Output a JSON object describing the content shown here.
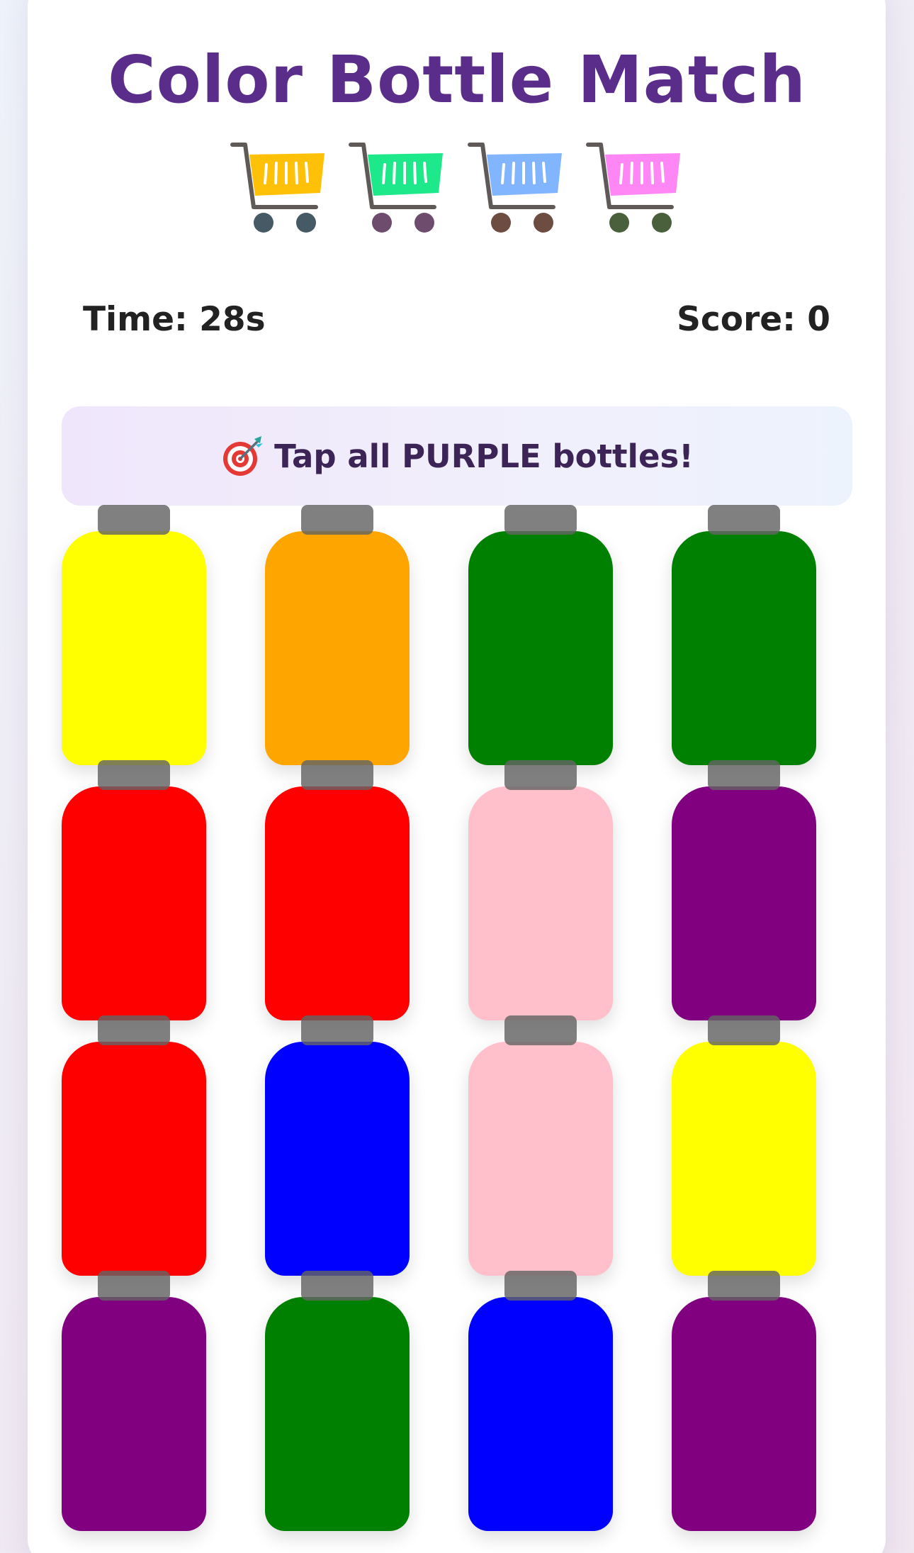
{
  "game": {
    "title": "Color Bottle Match",
    "timer_text": "Time: 28s",
    "score_text": "Score: 0",
    "instruction_icon": "target-dart-icon",
    "instruction_text": "Tap all PURPLE bottles!"
  },
  "carts": [
    {
      "icon": "shopping-cart-icon",
      "basket_color": "#ffc107",
      "wheel_color": "#455a64"
    },
    {
      "icon": "shopping-cart-icon",
      "basket_color": "#1de98b",
      "wheel_color": "#6d4c6e"
    },
    {
      "icon": "shopping-cart-icon",
      "basket_color": "#82b5ff",
      "wheel_color": "#6d4c41"
    },
    {
      "icon": "shopping-cart-icon",
      "basket_color": "#ff86f5",
      "wheel_color": "#4a5f3c"
    }
  ],
  "bottles": [
    {
      "color_name": "yellow",
      "color": "#ffff00"
    },
    {
      "color_name": "orange",
      "color": "#ffa500"
    },
    {
      "color_name": "green",
      "color": "#008000"
    },
    {
      "color_name": "green",
      "color": "#008000"
    },
    {
      "color_name": "red",
      "color": "#ff0000"
    },
    {
      "color_name": "red",
      "color": "#ff0000"
    },
    {
      "color_name": "pink",
      "color": "#ffc0cb"
    },
    {
      "color_name": "purple",
      "color": "#800080"
    },
    {
      "color_name": "red",
      "color": "#ff0000"
    },
    {
      "color_name": "blue",
      "color": "#0000ff"
    },
    {
      "color_name": "pink",
      "color": "#ffc0cb"
    },
    {
      "color_name": "yellow",
      "color": "#ffff00"
    },
    {
      "color_name": "purple",
      "color": "#800080"
    },
    {
      "color_name": "green",
      "color": "#008000"
    },
    {
      "color_name": "blue",
      "color": "#0000ff"
    },
    {
      "color_name": "purple",
      "color": "#800080"
    }
  ],
  "theme": {
    "title_color": "#5b2d8a",
    "cap_color": "#646464",
    "card_background": "#ffffff"
  }
}
